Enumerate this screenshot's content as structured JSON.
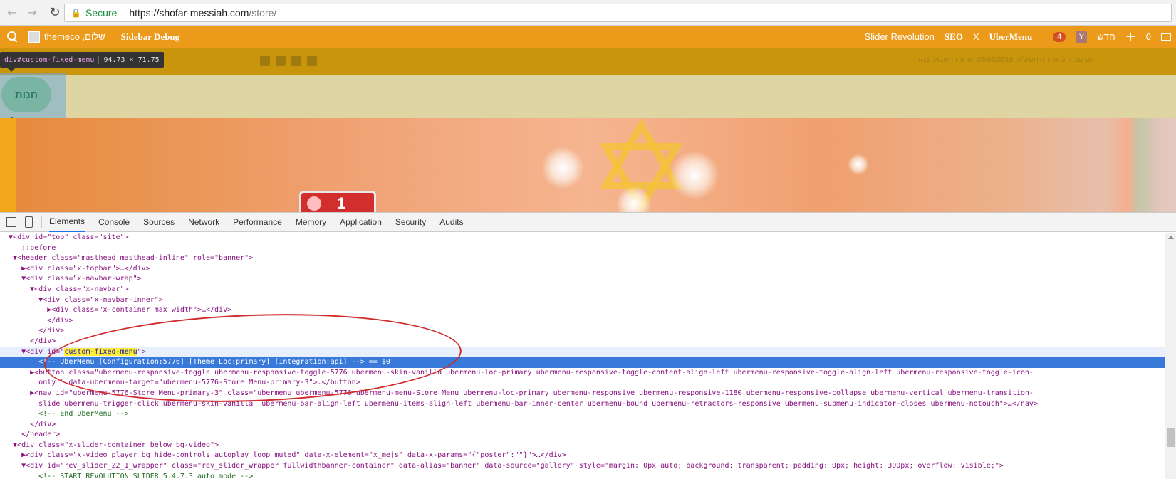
{
  "browser": {
    "secure_label": "Secure",
    "url_host": "https://shofar-messiah.com",
    "url_path": "/store/"
  },
  "adminbar": {
    "user_name": "themeco ,שלום",
    "sidebar_debug": "Sidebar Debug",
    "slider_revolution": "Slider Revolution",
    "seo": "SEO",
    "x": "X",
    "ubermenu": "UberMenu",
    "updates_count": "4",
    "new_label": "חדש",
    "comments_count": "0",
    "accent_color": "#ec9a1a"
  },
  "topbar": {
    "inspect_tag": "div#custom-fixed-menu",
    "inspect_dims": "94.73 × 71.75",
    "hebrew_date": "יום שבת, כ' אייר ה'תשע\"ח, 05/05/2018, פרשת השבוע: בהר"
  },
  "header": {
    "store_label": "חנות"
  },
  "hero": {
    "slide_number": "1"
  },
  "devtools": {
    "tabs": [
      "Elements",
      "Console",
      "Sources",
      "Network",
      "Performance",
      "Memory",
      "Application",
      "Security",
      "Audits"
    ],
    "lines": [
      "  ▼<div id=\"top\" class=\"site\">",
      "     ::before",
      "   ▼<header class=\"masthead masthead-inline\" role=\"banner\">",
      "     ▶<div class=\"x-topbar\">…</div>",
      "     ▼<div class=\"x-navbar-wrap\">",
      "       ▼<div class=\"x-navbar\">",
      "         ▼<div class=\"x-navbar-inner\">",
      "           ▶<div class=\"x-container max width\">…</div>",
      "           </div>",
      "         </div>",
      "       </div>",
      "     ▼<div id=\"custom-fixed-menu\">",
      "         <!-- UberMenu [Configuration:5776] [Theme Loc:primary] [Integration:api] --> == $0",
      "       ▶<button class=\"ubermenu-responsive-toggle ubermenu-responsive-toggle-5776 ubermenu-skin-vanilla ubermenu-loc-primary ubermenu-responsive-toggle-content-align-left ubermenu-responsive-toggle-align-left ubermenu-responsive-toggle-icon-",
      "         only \" data-ubermenu-target=\"ubermenu-5776-Store Menu-primary-3\">…</button>",
      "       ▶<nav id=\"ubermenu-5776-Store Menu-primary-3\" class=\"ubermenu ubermenu-5776 ubermenu-menu-Store Menu ubermenu-loc-primary ubermenu-responsive ubermenu-responsive-1180 ubermenu-responsive-collapse ubermenu-vertical ubermenu-transition-",
      "         slide ubermenu-trigger-click ubermenu-skin-vanilla  ubermenu-bar-align-left ubermenu-items-align-left ubermenu-bar-inner-center ubermenu-bound ubermenu-retractors-responsive ubermenu-submenu-indicator-closes ubermenu-notouch\">…</nav>",
      "         <!-- End UberMenu -->",
      "       </div>",
      "     </header>",
      "   ▼<div class=\"x-slider-container below bg-video\">",
      "     ▶<div class=\"x-video player bg hide-controls autoplay loop muted\" data-x-element=\"x_mejs\" data-x-params=\"{\"poster\":\"\"}\">…</div>",
      "     ▼<div id=\"rev_slider_22_1_wrapper\" class=\"rev_slider_wrapper fullwidthbanner-container\" data-alias=\"banner\" data-source=\"gallery\" style=\"margin: 0px auto; background: transparent; padding: 0px; height: 300px; overflow: visible;\">",
      "         <!-- START REVOLUTION SLIDER 5.4.7.3 auto mode -->"
    ]
  }
}
